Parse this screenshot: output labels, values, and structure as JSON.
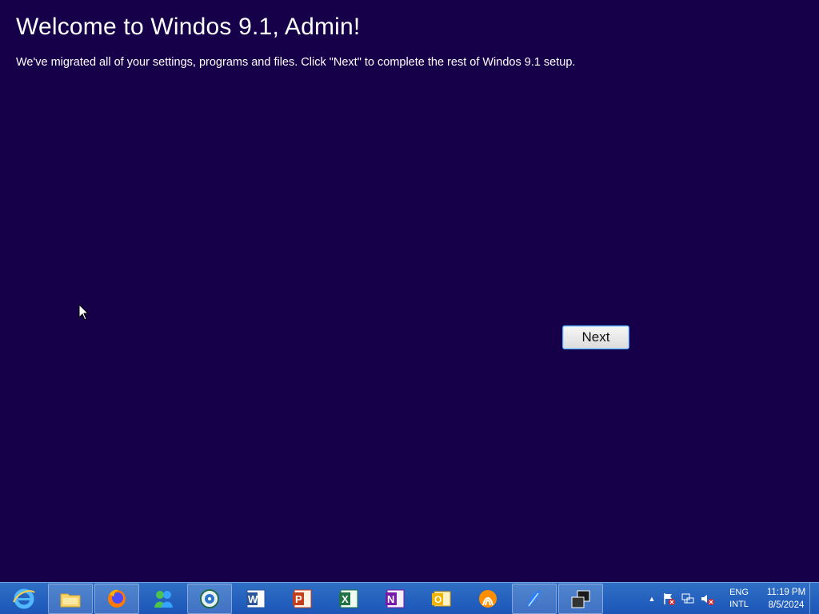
{
  "setup": {
    "title": "Welcome to Windos 9.1, Admin!",
    "message": "We've migrated all of your settings, programs and files. Click \"Next\" to complete the rest of Windos 9.1 setup.",
    "next_label": "Next"
  },
  "taskbar": {
    "apps": [
      {
        "name": "internet-explorer-icon",
        "running": false
      },
      {
        "name": "file-explorer-icon",
        "running": true
      },
      {
        "name": "firefox-icon",
        "running": true
      },
      {
        "name": "messenger-icon",
        "running": false
      },
      {
        "name": "media-center-icon",
        "running": true
      },
      {
        "name": "word-icon",
        "running": false
      },
      {
        "name": "powerpoint-icon",
        "running": false
      },
      {
        "name": "excel-icon",
        "running": false
      },
      {
        "name": "onenote-icon",
        "running": false
      },
      {
        "name": "outlook-icon",
        "running": false
      },
      {
        "name": "vlc-like-icon",
        "running": false
      },
      {
        "name": "app-feather-icon",
        "running": true
      },
      {
        "name": "window-switcher-icon",
        "running": true
      }
    ],
    "tray": {
      "language_top": "ENG",
      "language_bottom": "INTL",
      "time": "11:19 PM",
      "date": "8/5/2024"
    }
  },
  "colors": {
    "background": "#17004a",
    "taskbar": "#1c56b8",
    "button_border": "#4f9ef0"
  }
}
